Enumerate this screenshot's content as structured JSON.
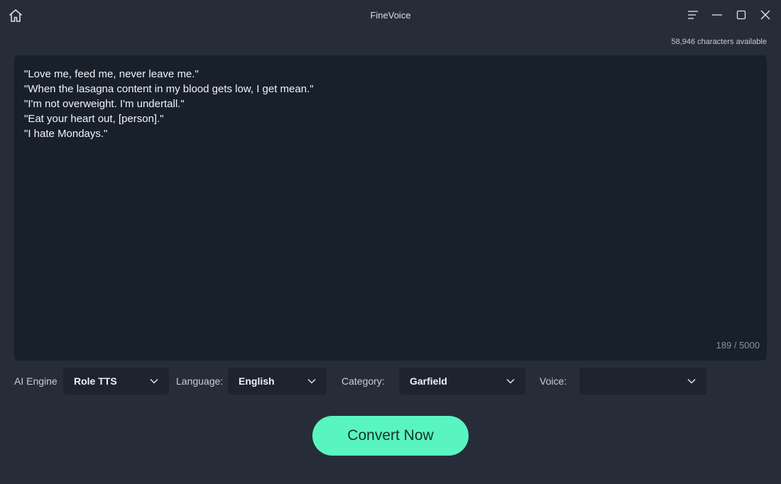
{
  "window": {
    "title": "FineVoice"
  },
  "header": {
    "chars_available": "58,946 characters available"
  },
  "editor": {
    "text": "\"Love me, feed me, never leave me.\"\n\"When the lasagna content in my blood gets low, I get mean.\"\n\"I'm not overweight. I'm undertall.\"\n\"Eat your heart out, [person].\"\n\"I hate Mondays.\"",
    "counter": "189 / 5000"
  },
  "controls": {
    "ai_engine_label": "AI Engine",
    "ai_engine_value": "Role TTS",
    "language_label": "Language:",
    "language_value": "English",
    "category_label": "Category:",
    "category_value": "Garfield",
    "voice_label": "Voice:",
    "voice_value": ""
  },
  "actions": {
    "convert_label": "Convert Now"
  },
  "icons": {
    "home": "home-icon",
    "menu": "menu-icon",
    "minimize": "minimize-icon",
    "maximize": "maximize-icon",
    "close": "close-icon",
    "dropdown": "chevron-down-icon"
  },
  "colors": {
    "background": "#262d39",
    "editor_background": "#18202c",
    "dropdown_background": "#1d2430",
    "accent": "#59f5c1"
  }
}
